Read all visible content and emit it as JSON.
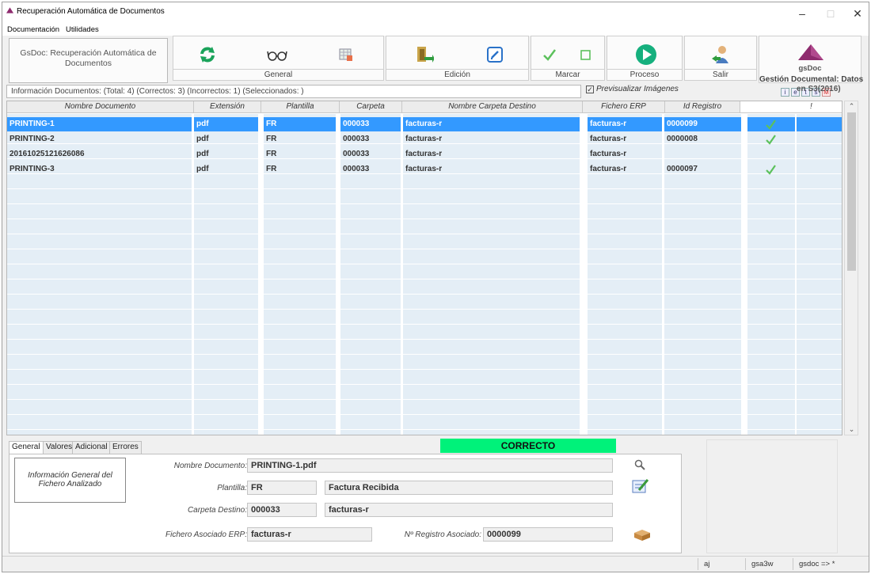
{
  "window": {
    "title": "Recuperación Automática de Documentos",
    "controls": [
      "–",
      "□",
      "✕"
    ]
  },
  "menu": [
    "Documentación",
    "Utilidades"
  ],
  "toolbar": {
    "app_title": "GsDoc: Recuperación Automática de Documentos",
    "groups": [
      {
        "label": "General",
        "icons": [
          "refresh-icon",
          "glasses-icon",
          "spreadsheet-icon"
        ]
      },
      {
        "label": "Edición",
        "icons": [
          "exit-door-icon",
          "edit-icon"
        ]
      },
      {
        "label": "Marcar",
        "icons": [
          "check-mark-icon",
          "empty-checkbox-icon"
        ]
      },
      {
        "label": "Proceso",
        "icons": [
          "play-icon"
        ]
      },
      {
        "label": "Salir",
        "icons": [
          "user-exit-icon"
        ]
      }
    ],
    "logo": {
      "brand": "gsDoc",
      "subtitle": "Gestión Documental: Datos"
    },
    "mini_icon_labels": [
      "i",
      "e",
      "t",
      "s",
      "M"
    ]
  },
  "info_bar": "Información Documentos: (Total: 4) (Correctos: 3) (Incorrectos: 1) (Seleccionados: )",
  "preview_checkbox": {
    "label": "Previsualizar Imágenes",
    "checked": true
  },
  "overlay_text": "en S3(2016)",
  "grid": {
    "columns": [
      "Nombre Documento",
      "Extensión",
      "Plantilla",
      "Carpeta",
      "Nombre Carpeta Destino",
      "Fichero ERP",
      "Id Registro",
      "",
      "!"
    ],
    "rows": [
      {
        "nombre": "PRINTING-1",
        "ext": "pdf",
        "plantilla": "FR",
        "carpeta": "000033",
        "destino": "facturas-r",
        "erp": "facturas-r",
        "id": "0000099",
        "ok": true,
        "selected": true
      },
      {
        "nombre": "PRINTING-2",
        "ext": "pdf",
        "plantilla": "FR",
        "carpeta": "000033",
        "destino": "facturas-r",
        "erp": "facturas-r",
        "id": "0000008",
        "ok": true,
        "selected": false
      },
      {
        "nombre": "20161025121626086",
        "ext": "pdf",
        "plantilla": "FR",
        "carpeta": "000033",
        "destino": "facturas-r",
        "erp": "facturas-r",
        "id": "",
        "ok": false,
        "selected": false
      },
      {
        "nombre": "PRINTING-3",
        "ext": "pdf",
        "plantilla": "FR",
        "carpeta": "000033",
        "destino": "facturas-r",
        "erp": "facturas-r",
        "id": "0000097",
        "ok": true,
        "selected": false
      }
    ]
  },
  "tabs": [
    "General",
    "Valores",
    "Adicional",
    "Errores"
  ],
  "status_banner": "CORRECTO",
  "details": {
    "description": "Información General del Fichero Analizado",
    "nombre_label": "Nombre Documento:",
    "nombre_value": "PRINTING-1.pdf",
    "plantilla_label": "Plantilla:",
    "plantilla_code": "FR",
    "plantilla_name": "Factura Recibida",
    "carpeta_label": "Carpeta Destino:",
    "carpeta_code": "000033",
    "carpeta_name": "facturas-r",
    "erp_label": "Fichero Asociado ERP:",
    "erp_value": "facturas-r",
    "registro_label": "Nº Registro Asociado:",
    "registro_value": "0000099"
  },
  "statusbar": [
    "aj",
    "gsa3w",
    "gsdoc => *"
  ],
  "colors": {
    "selection": "#3399ff",
    "correct_banner": "#00f27a",
    "check": "#5cc15c",
    "row_alt": "#e4eef6"
  }
}
